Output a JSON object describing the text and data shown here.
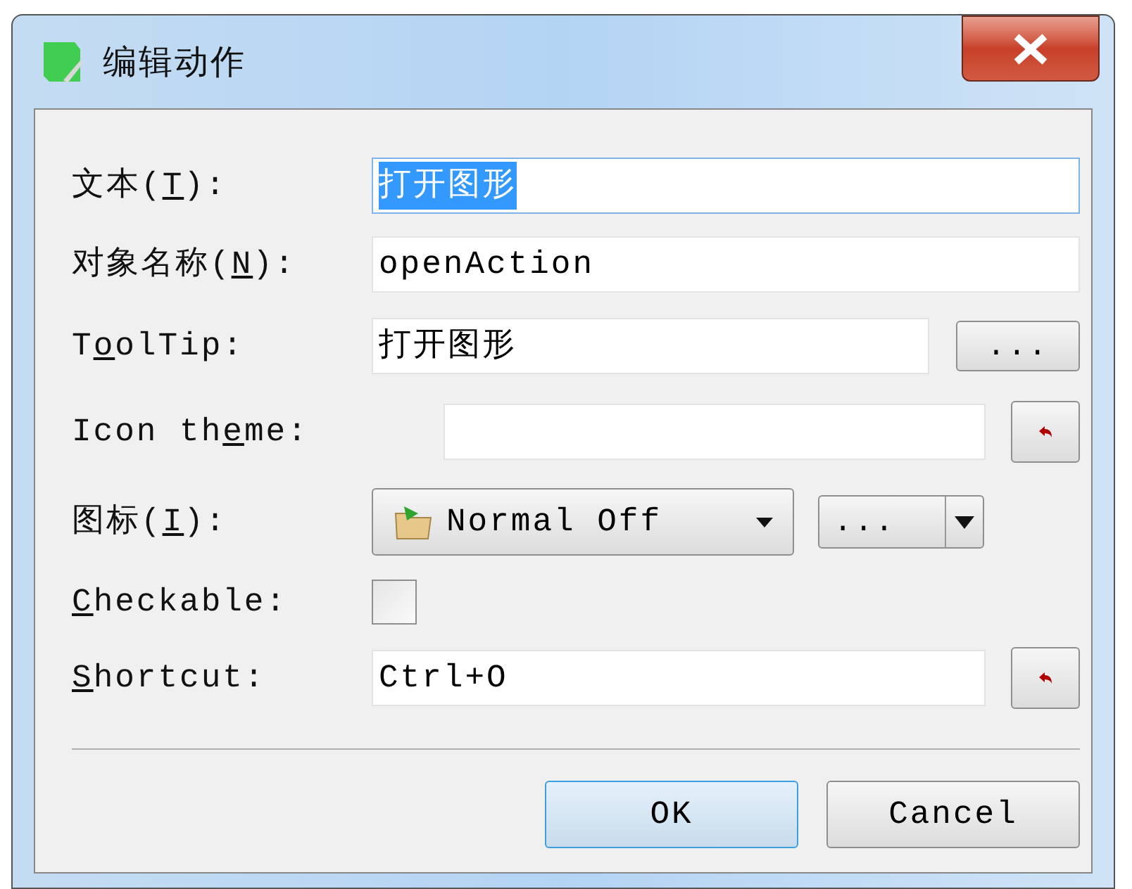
{
  "window": {
    "title": "编辑动作"
  },
  "fields": [
    {
      "kind": "text",
      "label": {
        "before": "文本(",
        "key": "T",
        "after": "):"
      },
      "value": "打开图形",
      "text_selected": true
    },
    {
      "kind": "text",
      "label": {
        "before": "对象名称(",
        "key": "N",
        "after": "):"
      },
      "value": "openAction"
    },
    {
      "kind": "text_more",
      "label": {
        "before": "T",
        "key": "o",
        "after": "olTip:"
      },
      "value": "打开图形",
      "button": "..."
    },
    {
      "kind": "text_reset",
      "label": {
        "before": "Icon th",
        "key": "e",
        "after": "me:"
      }
    },
    {
      "kind": "icon",
      "label": {
        "before": "图标(",
        "key": "I",
        "after": "):"
      },
      "value": "Normal Off",
      "button": "..."
    },
    {
      "kind": "checkbox",
      "label": {
        "key": "C",
        "after": "heckable:"
      },
      "checked": false
    },
    {
      "kind": "text_reset",
      "label": {
        "key": "S",
        "after": "hortcut:"
      },
      "value": "Ctrl+O"
    }
  ],
  "buttons": [
    {
      "label": "OK",
      "default": true
    },
    {
      "label": "Cancel",
      "default": false
    }
  ]
}
